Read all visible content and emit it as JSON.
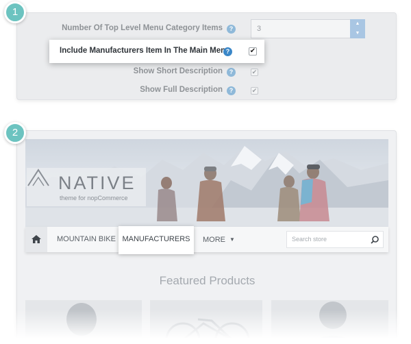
{
  "steps": {
    "one": "1",
    "two": "2"
  },
  "settings": {
    "top_level_label": "Number Of Top Level Menu Category Items",
    "top_level_value": "3",
    "include_manufacturers_label": "Include Manufacturers Item In The Main Menu",
    "include_manufacturers_checked": true,
    "short_description_label": "Show Short Description",
    "short_description_checked": true,
    "full_description_label": "Show Full Description",
    "full_description_checked": true,
    "help_glyph": "?",
    "check_glyph": "✔",
    "spin_up": "▲",
    "spin_down": "▼"
  },
  "store": {
    "logo_text": "NATIVE",
    "logo_tagline": "theme for nopCommerce",
    "nav": {
      "mountain_bike": "MOUNTAIN BIKE",
      "manufacturers": "MANUFACTURERS",
      "more": "MORE",
      "more_caret": "▼"
    },
    "search_placeholder": "Search store",
    "featured_title": "Featured Products"
  },
  "colors": {
    "accent": "#6cc3c0",
    "help": "#3a87c8"
  },
  "icons": [
    "help-icon",
    "home-icon",
    "search-icon",
    "chevron-down-icon",
    "checkbox-checked-icon"
  ]
}
